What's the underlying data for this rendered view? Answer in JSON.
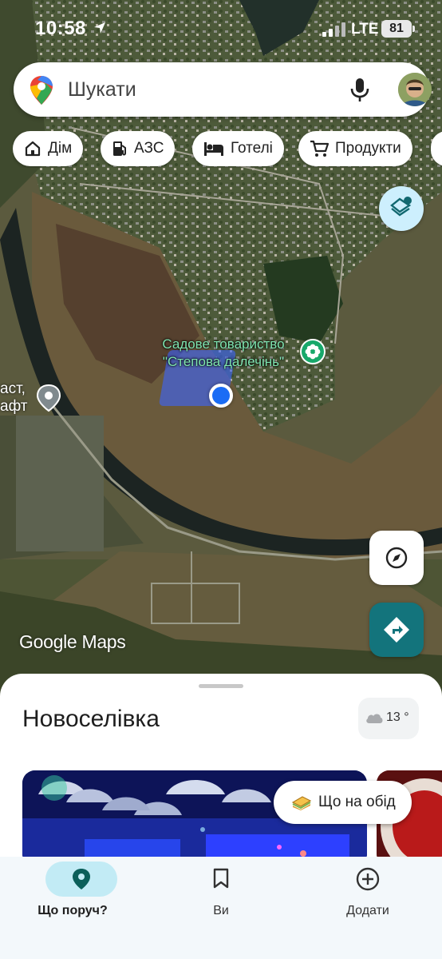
{
  "status_bar": {
    "time": "10:58",
    "network": "LTE",
    "battery": "81"
  },
  "search": {
    "placeholder": "Шукати"
  },
  "chips": [
    {
      "label": "Дім",
      "icon": "home-icon"
    },
    {
      "label": "АЗС",
      "icon": "gas-station-icon"
    },
    {
      "label": "Готелі",
      "icon": "hotel-bed-icon"
    },
    {
      "label": "Продукти",
      "icon": "shopping-cart-icon"
    }
  ],
  "map": {
    "poi_name_line1": "Садове товариство",
    "poi_name_line2": "\"Степова далечінь\"",
    "left_label_line1": "аст,",
    "left_label_line2": "афт",
    "brand": "Google Maps"
  },
  "sheet": {
    "title": "Новоселівка",
    "temperature": "13 °",
    "lunch_chip": "Що на обід"
  },
  "bottom_nav": [
    {
      "label": "Що поруч?",
      "icon": "location-pin-icon",
      "active": true
    },
    {
      "label": "Ви",
      "icon": "bookmark-icon",
      "active": false
    },
    {
      "label": "Додати",
      "icon": "add-circle-icon",
      "active": false
    }
  ],
  "colors": {
    "accent": "#13747c",
    "active_pill": "#c2ebf5",
    "poi_green": "#17a86a",
    "location_blue": "#1a6cf5"
  }
}
